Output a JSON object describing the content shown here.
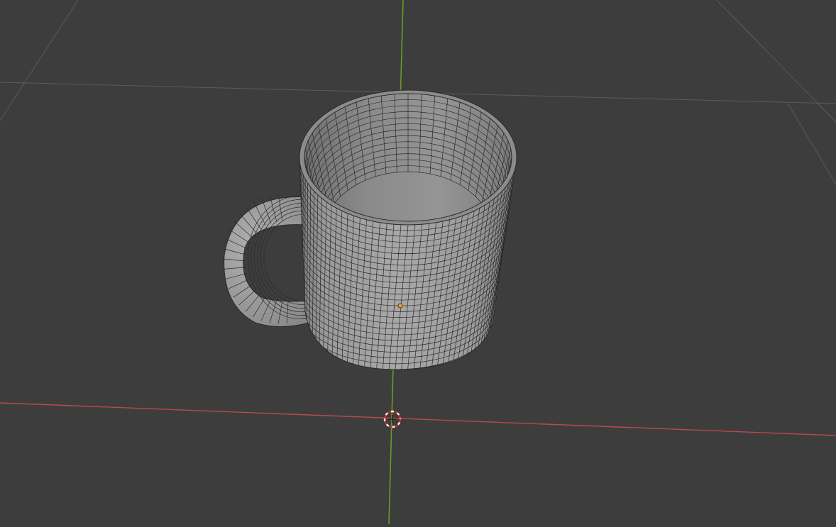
{
  "viewport": {
    "background": "#3d3d3d",
    "grid_color": "#5b5b5b",
    "x_axis_color": "#b9494f",
    "y_axis_color": "#6a9a27",
    "mesh_fill": "#9c9c9c",
    "mesh_wire": "#2b2b2b",
    "origin_color": "#f5a31a",
    "cursor_red": "#d8242b",
    "cursor_white": "#f2f2f2"
  },
  "scene": {
    "object": "mug",
    "mode": "wireframe-overlay",
    "icons": [
      "3d-cursor-icon",
      "object-origin-icon"
    ]
  }
}
